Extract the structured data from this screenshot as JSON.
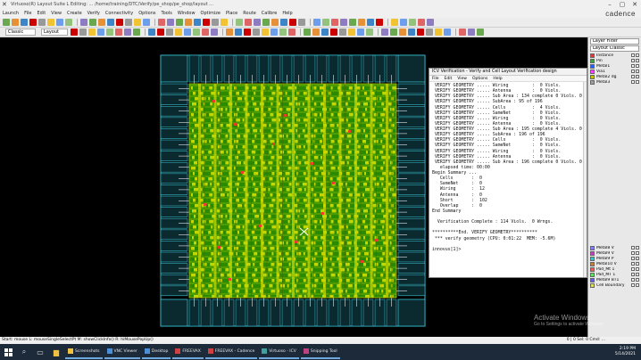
{
  "window": {
    "title": "Virtuoso(R) Layout Suite L Editing: ...  /home/training/DTC/Verify/pe_shop/pe_shop/layout ..."
  },
  "menu": {
    "items": [
      "Launch",
      "File",
      "Edit",
      "View",
      "Create",
      "Verify",
      "Connectivity",
      "Options",
      "Tools",
      "Window",
      "Optimize",
      "Place",
      "Route",
      "Calibre",
      "Help"
    ],
    "brand": "cadence"
  },
  "toolbar": {
    "workspace_value": "Classic",
    "layer_field": "Layout"
  },
  "palette": {
    "search_placeholder": "Layer Filter",
    "mode_label": "Layout Classic",
    "layers": [
      {
        "name": "Instance",
        "color": "#d04040"
      },
      {
        "name": "Pin",
        "color": "#40a040"
      },
      {
        "name": "Metal1",
        "color": "#2060ff"
      },
      {
        "name": "Via1",
        "color": "#ff40ff"
      },
      {
        "name": "Metal2 dg",
        "color": "#c0c000"
      },
      {
        "name": "Metal3",
        "color": "#a0a0a0"
      }
    ],
    "lower_layers": [
      {
        "name": "Metal8 V",
        "color": "#8080ff"
      },
      {
        "name": "Metal9 V",
        "color": "#c040c0"
      },
      {
        "name": "Metal9 P",
        "color": "#40c0c0"
      },
      {
        "name": "Metal10 V",
        "color": "#c08040"
      },
      {
        "name": "Pad_Mt 1",
        "color": "#e06060"
      },
      {
        "name": "Pad_MT 1",
        "color": "#60e060"
      },
      {
        "name": "Metal9 BT1",
        "color": "#6060e0"
      },
      {
        "name": "Cell Boundary",
        "color": "#e0e060"
      }
    ]
  },
  "cmd_window": {
    "title": "ICV Verification - Verify and Cell Layout Verification design",
    "menu": [
      "File",
      "Edit",
      "View",
      "Options",
      "Help"
    ],
    "lines": [
      " VERIFY GEOMETRY ..... Wiring         :  0 Viols.",
      " VERIFY GEOMETRY ..... Antenna        :  0 Viols.",
      " VERIFY GEOMETRY ..... Sub Area : 134 complete 0 Viols. 0 Wrngs.",
      " VERIFY GEOMETRY ..... SubArea : 95 of 196",
      " VERIFY GEOMETRY ..... Cells          :  4 Viols.",
      " VERIFY GEOMETRY ..... SameNet        :  0 Viols.",
      " VERIFY GEOMETRY ..... Wiring         :  0 Viols.",
      " VERIFY GEOMETRY ..... Antenna        :  0 Viols.",
      " VERIFY GEOMETRY ..... Sub Area : 195 complete 4 Viols. 0 Wrngs.",
      " VERIFY GEOMETRY ..... SubArea : 196 of 196",
      " VERIFY GEOMETRY ..... Cells          :  0 Viols.",
      " VERIFY GEOMETRY ..... SameNet        :  0 Viols.",
      " VERIFY GEOMETRY ..... Wiring         :  0 Viols.",
      " VERIFY GEOMETRY ..... Antenna        :  0 Viols.",
      " VERIFY GEOMETRY ..... Sub Area : 196 complete 0 Viols. 0 Wrngs.",
      "   elapsed time: 00:00",
      "Begin Summary ...",
      "   Cells       :  0",
      "   SameNet     :  0",
      "   Wiring      :  12",
      "   Antenna     :  0",
      "   Short       :  102",
      "   Overlap     :  0",
      "End Summary",
      "",
      "  Verification Complete : 114 Viols.  0 Wrngs.",
      "",
      "**********End. VERIFY GEOMETRY**********",
      " *** verify geometry (CPU: 0:01:22  MEM: -5.6M)",
      "",
      "innovus[1]> "
    ]
  },
  "status": {
    "left": "Start: mouse L: mouseSingleSelectPt   M: showClickInfo()   R: hiMousePopUp()",
    "right": "0 | 0 Sel: 0   Cmd: ..."
  },
  "watermark": {
    "line1": "Activate Windows",
    "line2": "Go to Settings to activate Windows."
  },
  "taskbar": {
    "items": [
      "Screenshots",
      "VNC Viewer",
      "Desktop",
      "FREEVAX",
      "FREEVAX - Cadence",
      "Virtuoso - ICV",
      "Snipping Tool"
    ],
    "time": "2:19 PM",
    "date": "5/14/2021"
  }
}
